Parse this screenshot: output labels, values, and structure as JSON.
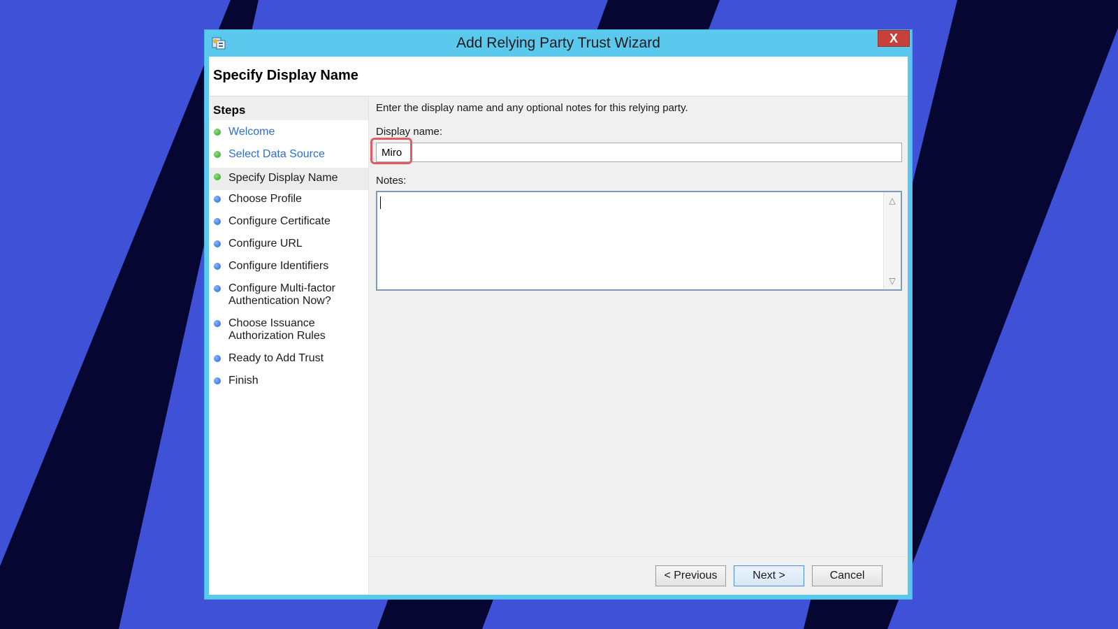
{
  "window": {
    "title": "Add Relying Party Trust Wizard",
    "close_label": "X"
  },
  "header": {
    "title": "Specify Display Name"
  },
  "steps": {
    "heading": "Steps",
    "items": [
      {
        "label": "Welcome",
        "state": "completed-link",
        "dot": "green"
      },
      {
        "label": "Select Data Source",
        "state": "completed-link",
        "dot": "green"
      },
      {
        "label": "Specify Display Name",
        "state": "current",
        "dot": "green"
      },
      {
        "label": "Choose Profile",
        "state": "pending",
        "dot": "blue"
      },
      {
        "label": "Configure Certificate",
        "state": "pending",
        "dot": "blue"
      },
      {
        "label": "Configure URL",
        "state": "pending",
        "dot": "blue"
      },
      {
        "label": "Configure Identifiers",
        "state": "pending",
        "dot": "blue"
      },
      {
        "label": "Configure Multi-factor Authentication Now?",
        "state": "pending",
        "dot": "blue"
      },
      {
        "label": "Choose Issuance Authorization Rules",
        "state": "pending",
        "dot": "blue"
      },
      {
        "label": "Ready to Add Trust",
        "state": "pending",
        "dot": "blue"
      },
      {
        "label": "Finish",
        "state": "pending",
        "dot": "blue"
      }
    ]
  },
  "form": {
    "instruction": "Enter the display name and any optional notes for this relying party.",
    "display_name_label": "Display name:",
    "display_name_value": "Miro",
    "notes_label": "Notes:",
    "notes_value": ""
  },
  "buttons": {
    "previous": "< Previous",
    "next": "Next >",
    "cancel": "Cancel"
  },
  "colors": {
    "background": "#3f51d6",
    "stripes": "#060633",
    "window_frame": "#5bc8ee",
    "highlight": "#e25b64",
    "link": "#2d6fd8"
  }
}
